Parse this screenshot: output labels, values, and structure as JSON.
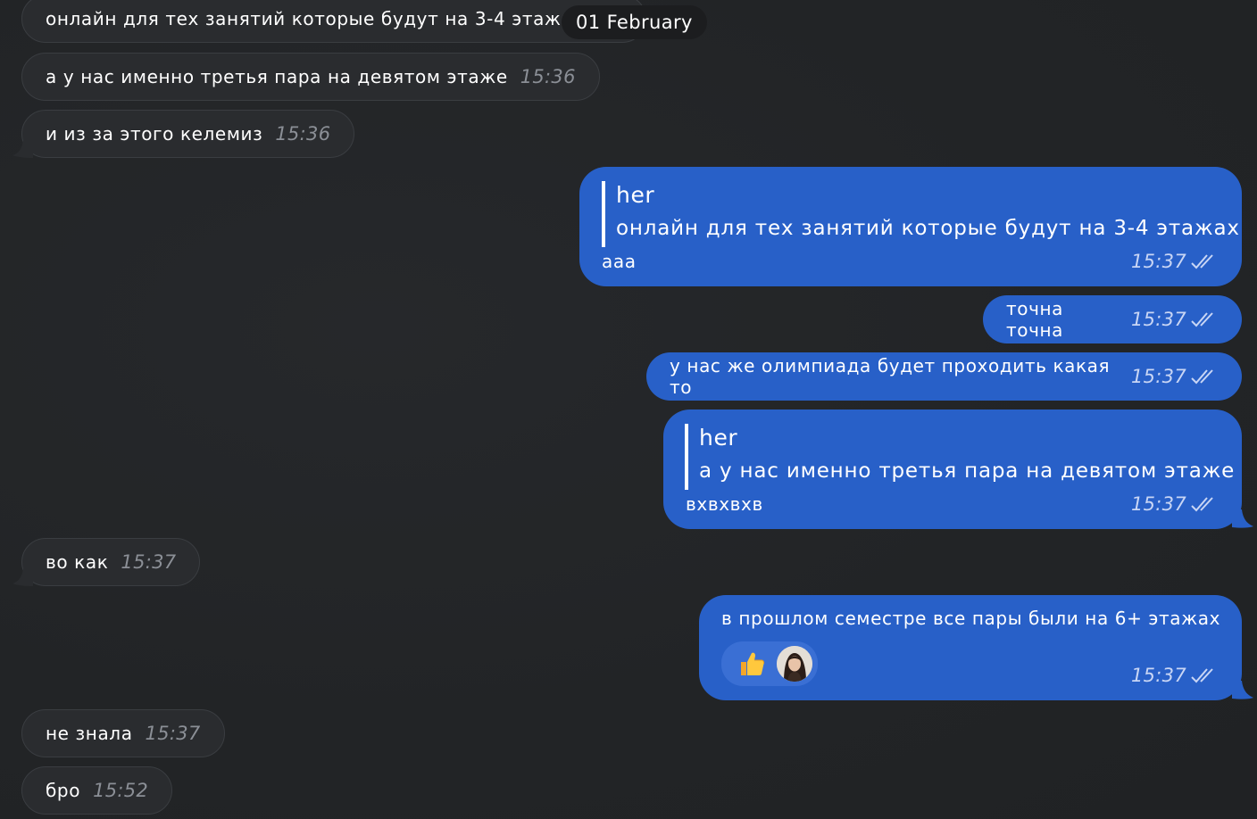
{
  "date_separator": "01 February",
  "messages": {
    "in_1": {
      "text": "онлайн для тех занятий которые будут на 3-4 этажах"
    },
    "in_2": {
      "text": "а у нас именно третья пара на девятом этаже",
      "time": "15:36"
    },
    "in_3": {
      "text": "и из за этого келемиз",
      "time": "15:36"
    },
    "out_1": {
      "quote_author": "her",
      "quote_text": "онлайн для тех занятий которые будут на 3-4 этажах",
      "text": "ааа",
      "time": "15:37"
    },
    "out_2": {
      "text": "точна точна",
      "time": "15:37"
    },
    "out_3": {
      "text": "у нас же олимпиада будет проходить какая то",
      "time": "15:37"
    },
    "out_4": {
      "quote_author": "her",
      "quote_text": "а у нас именно третья пара на девятом этаже",
      "text": "вхвхвхв",
      "time": "15:37"
    },
    "in_4": {
      "text": "во как",
      "time": "15:37"
    },
    "out_5": {
      "text": "в прошлом семестре все пары были на 6+ этажах",
      "time": "15:37",
      "reaction_emoji": "thumbs-up-icon"
    },
    "in_5": {
      "text": "не знала",
      "time": "15:37"
    },
    "in_6": {
      "text": "бро",
      "time": "15:52"
    }
  },
  "colors": {
    "background": "#232527",
    "incoming_bubble": "#2a2c2f",
    "outgoing_bubble": "#2860c8",
    "date_pill": "#1c1d1f"
  }
}
